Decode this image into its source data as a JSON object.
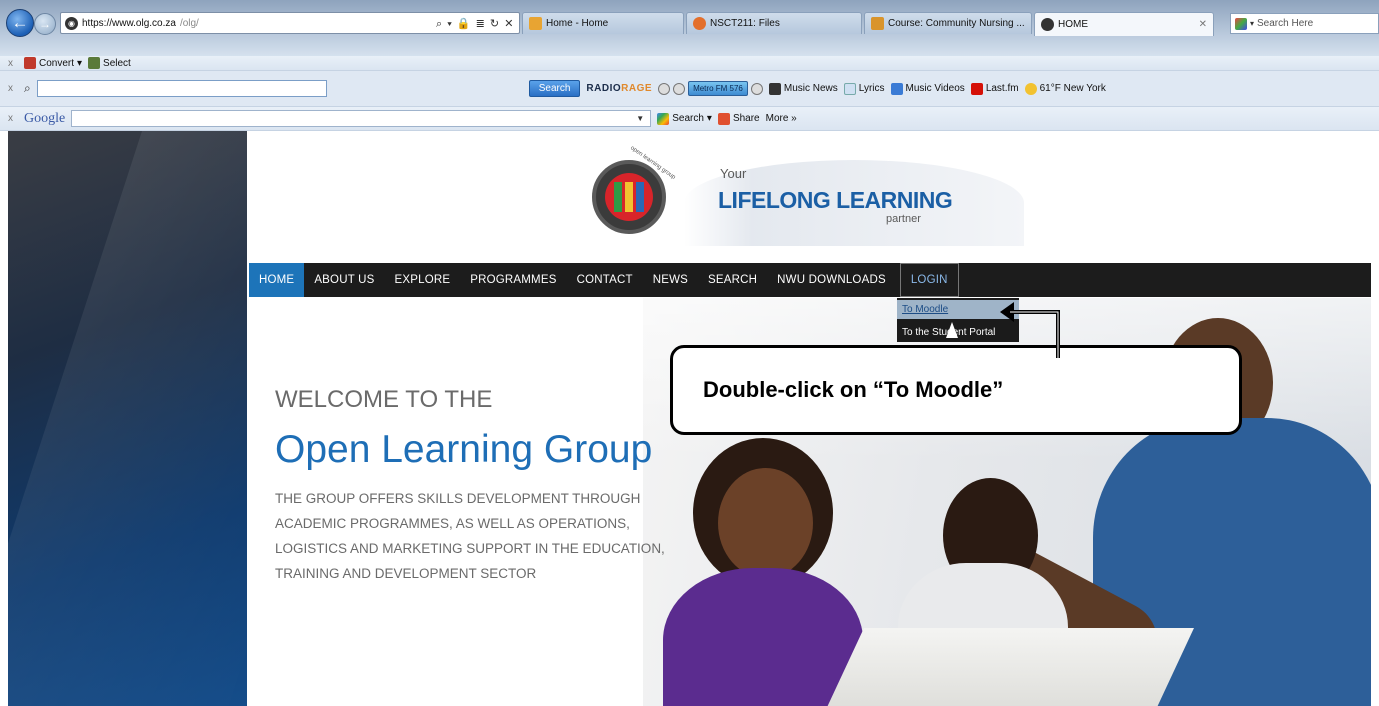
{
  "browser": {
    "address": {
      "url": "https://www.olg.co.za",
      "path": "/olg/"
    },
    "address_tools": "⌕ ▾ 🔒 ≣ ↻ ✕",
    "tabs": [
      {
        "label": "Home - Home",
        "color": "#e8a432"
      },
      {
        "label": "NSCT211: Files",
        "color": "#e36f2c"
      },
      {
        "label": "Course: Community Nursing ...",
        "color": "#d9942b"
      },
      {
        "label": "HOME",
        "color": "#333333"
      }
    ],
    "search_placeholder": "Search Here"
  },
  "toolbar1": {
    "convert": "Convert",
    "select": "Select"
  },
  "toolbar2": {
    "search_button": "Search",
    "radio_logo_a": "RADIO",
    "radio_logo_b": "RAGE",
    "station": "Metro FM 576",
    "links": [
      "Music News",
      "Lyrics",
      "Music Videos",
      "Last.fm",
      "61°F New York"
    ]
  },
  "toolbar3": {
    "google": "Google",
    "search": "Search",
    "share": "Share",
    "more": "More »"
  },
  "site": {
    "logo_arc": "open learning group",
    "tagline_your": "Your",
    "tagline_main": "LIFELONG LEARNING",
    "tagline_partner": "partner",
    "nav": [
      "HOME",
      "ABOUT US",
      "EXPLORE",
      "PROGRAMMES",
      "CONTACT",
      "NEWS",
      "SEARCH",
      "NWU DOWNLOADS",
      "LOGIN"
    ],
    "dropdown": {
      "moodle": "To Moodle",
      "portal": "To the Student Portal"
    },
    "welcome": "WELCOME TO THE",
    "title": "Open Learning Group",
    "intro_lines": [
      "THE GROUP OFFERS SKILLS DEVELOPMENT THROUGH",
      "ACADEMIC PROGRAMMES, AS WELL AS OPERATIONS,",
      "LOGISTICS AND MARKETING SUPPORT IN THE EDUCATION,",
      "TRAINING AND DEVELOPMENT SECTOR"
    ]
  },
  "callout": {
    "text": "Double-click on “To Moodle”"
  }
}
